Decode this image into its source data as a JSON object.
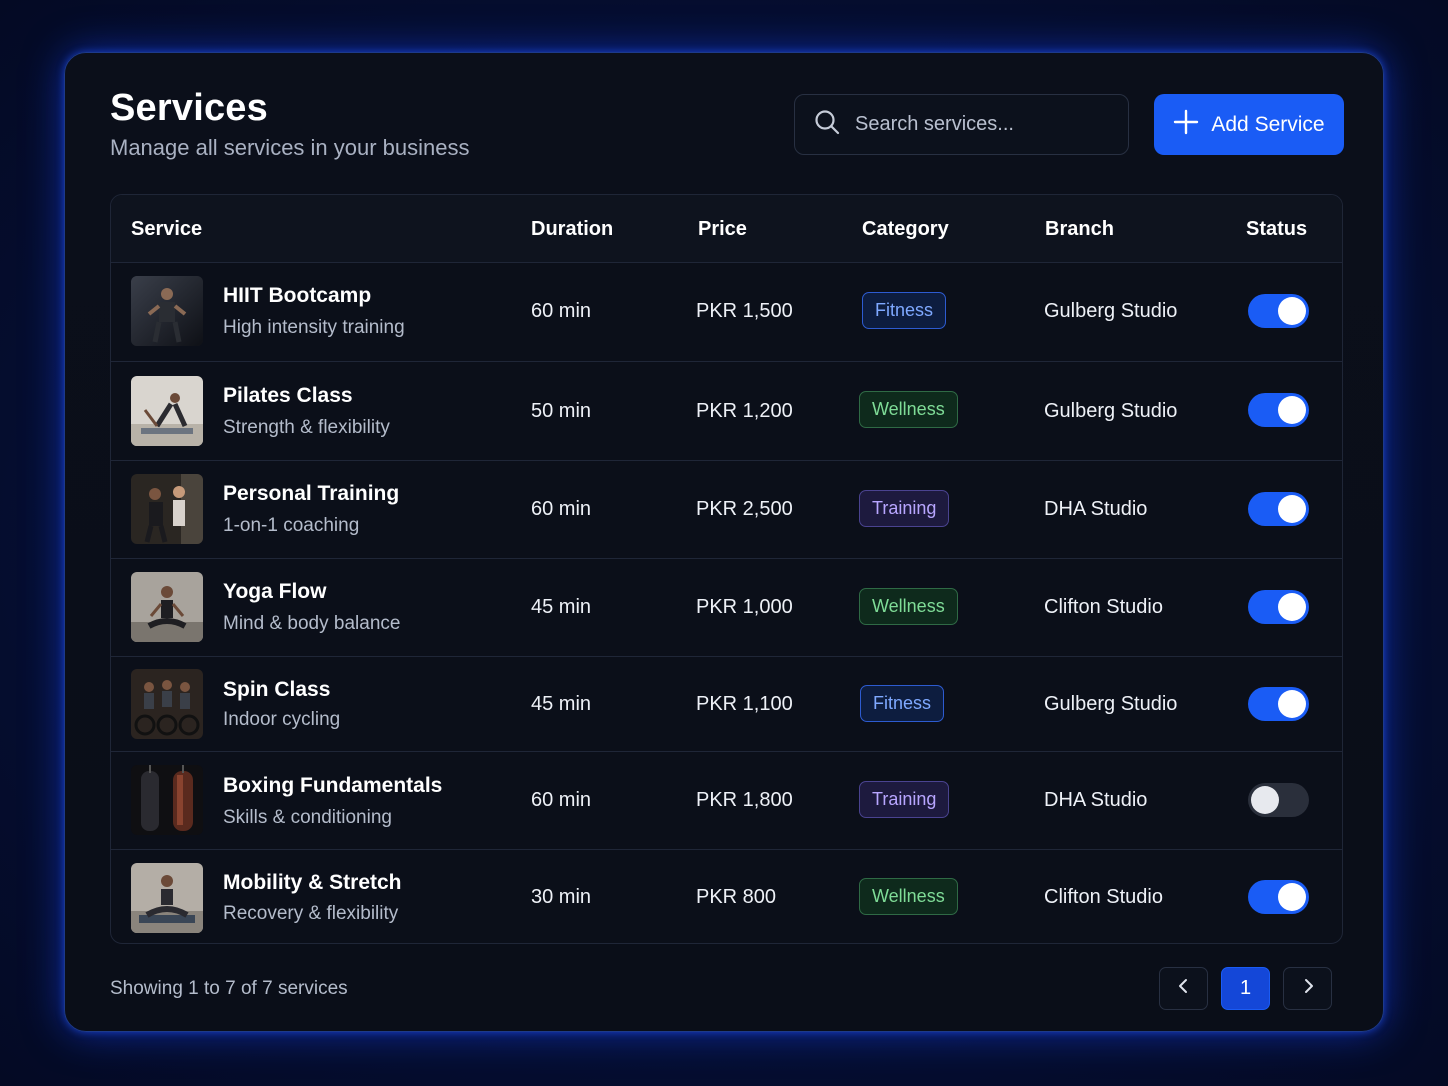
{
  "header": {
    "title": "Services",
    "subtitle": "Manage all services in your business"
  },
  "search": {
    "placeholder": "Search services...",
    "icon": "search-icon"
  },
  "toolbar": {
    "add_label": "Add Service",
    "add_icon": "plus-icon"
  },
  "table": {
    "columns": [
      "Service",
      "Duration",
      "Price",
      "Category",
      "Branch",
      "Status"
    ],
    "rows": [
      {
        "name": "HIIT Bootcamp",
        "desc": "High intensity training",
        "duration": "60 min",
        "price": "PKR 1,500",
        "category": "Fitness",
        "branch": "Gulberg Studio",
        "status": true
      },
      {
        "name": "Pilates Class",
        "desc": "Strength & flexibility",
        "duration": "50 min",
        "price": "PKR 1,200",
        "category": "Wellness",
        "branch": "Gulberg Studio",
        "status": true
      },
      {
        "name": "Personal Training",
        "desc": "1-on-1 coaching",
        "duration": "60 min",
        "price": "PKR 2,500",
        "category": "Training",
        "branch": "DHA Studio",
        "status": true
      },
      {
        "name": "Yoga Flow",
        "desc": "Mind & body balance",
        "duration": "45 min",
        "price": "PKR 1,000",
        "category": "Wellness",
        "branch": "Clifton Studio",
        "status": true
      },
      {
        "name": "Spin Class",
        "desc": "Indoor cycling",
        "duration": "45 min",
        "price": "PKR 1,100",
        "category": "Fitness",
        "branch": "Gulberg Studio",
        "status": true
      },
      {
        "name": "Boxing Fundamentals",
        "desc": "Skills & conditioning",
        "duration": "60 min",
        "price": "PKR 1,800",
        "category": "Training",
        "branch": "DHA Studio",
        "status": false
      },
      {
        "name": "Mobility & Stretch",
        "desc": "Recovery & flexibility",
        "duration": "30 min",
        "price": "PKR 800",
        "category": "Wellness",
        "branch": "Clifton Studio",
        "status": true
      }
    ]
  },
  "footer": {
    "summary": "Showing 1 to 7 of 7 services",
    "current_page": "1",
    "prev_icon": "chevron-left-icon",
    "next_icon": "chevron-right-icon"
  },
  "colors": {
    "accent": "#1a5cf5",
    "fitness": "#7fa9ff",
    "wellness": "#7fdc97",
    "training": "#b8a6ff"
  }
}
